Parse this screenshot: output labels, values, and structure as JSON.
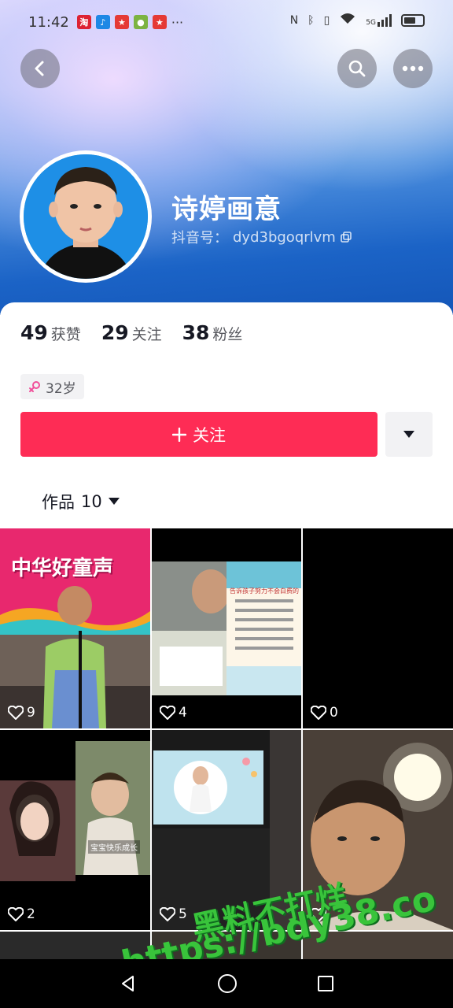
{
  "status_bar": {
    "time": "11:42",
    "signal_label": "5G"
  },
  "profile": {
    "nickname": "诗婷画意",
    "douyin_id_label": "抖音号：",
    "douyin_id": "dyd3bgoqrlvm"
  },
  "stats": [
    {
      "value": "49",
      "label": "获赞"
    },
    {
      "value": "29",
      "label": "关注"
    },
    {
      "value": "38",
      "label": "粉丝"
    }
  ],
  "age_tag": "32岁",
  "follow_button": "关注",
  "works_tab": {
    "label": "作品",
    "count": "10"
  },
  "videos": [
    {
      "likes": "9",
      "banner_title": "中华好童声"
    },
    {
      "likes": "4",
      "card_title": "告诉孩子努力不会白费的"
    },
    {
      "likes": "0"
    },
    {
      "likes": "2",
      "caption": "宝宝快乐成长"
    },
    {
      "likes": "5"
    },
    {
      "likes": ""
    }
  ],
  "watermark": {
    "line1": "黑料不打烊",
    "line2": "https://bdy38.co"
  },
  "colors": {
    "accent": "#fe2c55",
    "banner_blue": "#1b63c6",
    "watermark_green": "#39c43b"
  }
}
